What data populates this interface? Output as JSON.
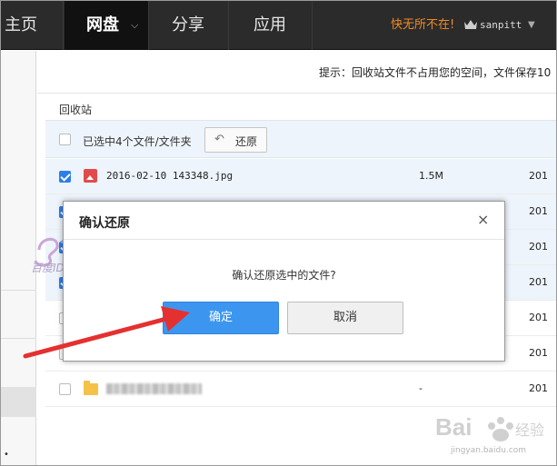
{
  "nav": {
    "home": "主页",
    "pan": "网盘",
    "share": "分享",
    "app": "应用",
    "slogan": "快无所不在!",
    "username": "sanpitt"
  },
  "tip": "提示：回收站文件不占用您的空间，文件保存10",
  "breadcrumb": "回收站",
  "toolbar": {
    "selected_text": "已选中4个文件/文件夹",
    "restore_label": "还原"
  },
  "rows": [
    {
      "name": "2016-02-10 143348.jpg",
      "size": "1.5M",
      "date": "201"
    },
    {
      "date": "201"
    },
    {
      "date": "201"
    },
    {
      "date": "201"
    },
    {
      "size": "-",
      "date": "201"
    },
    {
      "date": "201"
    },
    {
      "size": "-",
      "date": "201"
    }
  ],
  "dialog": {
    "title": "确认还原",
    "close": "×",
    "message": "确认还原选中的文件?",
    "ok_label": "确定",
    "cancel_label": "取消"
  },
  "watermark": {
    "left": "百度ID: Sanpitt",
    "right": "jingyan.baidu.com"
  },
  "colors": {
    "nav_bg": "#2b2b2b",
    "accent": "#3c96f0",
    "slogan": "#f08a24",
    "arrow": "#e53030"
  }
}
